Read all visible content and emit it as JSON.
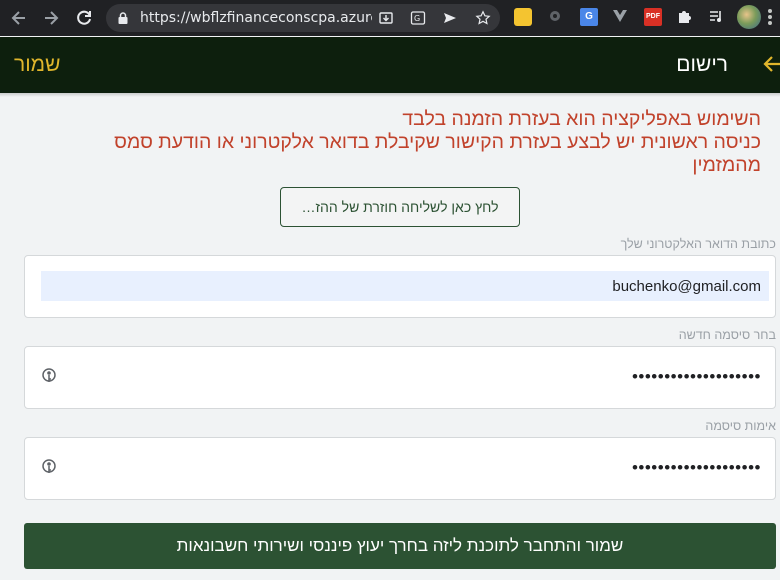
{
  "browser": {
    "url": "https://wbflzfinanceconscpa.azure…",
    "extensions": [
      "coin-extension-icon",
      "settings-gear-icon",
      "translate-extension-icon",
      "vue-extension-icon",
      "pdf-extension-icon",
      "puzzle-icon",
      "media-queue-icon"
    ]
  },
  "header": {
    "save_label": "שמור",
    "title": "רישום"
  },
  "notice": {
    "line1": "השימוש באפליקציה הוא בעזרת הזמנה בלבד",
    "line2": "כניסה ראשונית יש לבצע בעזרת הקישור שקיבלת בדואר אלקטרוני או הודעת סמס מהמזמין"
  },
  "resend_button": {
    "label": "לחץ כאן לשליחה חוזרת של ההז…"
  },
  "form": {
    "email": {
      "label": "כתובת הדואר האלקטרוני שלך",
      "value": "buchenko@gmail.com"
    },
    "new_password": {
      "label": "בחר סיסמה חדשה",
      "value": "••••••••••••••••••••"
    },
    "confirm_password": {
      "label": "אימות סיסמה",
      "value": "••••••••••••••••••••"
    }
  },
  "submit": {
    "label": "שמור והתחבר לתוכנת ליזה בחרך יעוץ פיננסי ושירותי חשבונאות"
  },
  "colors": {
    "header_bg": "#0d1f0d",
    "accent_gold": "#e0b62c",
    "notice_red": "#c1422b",
    "button_green": "#2c5233",
    "page_bg": "#f1f3f4"
  }
}
